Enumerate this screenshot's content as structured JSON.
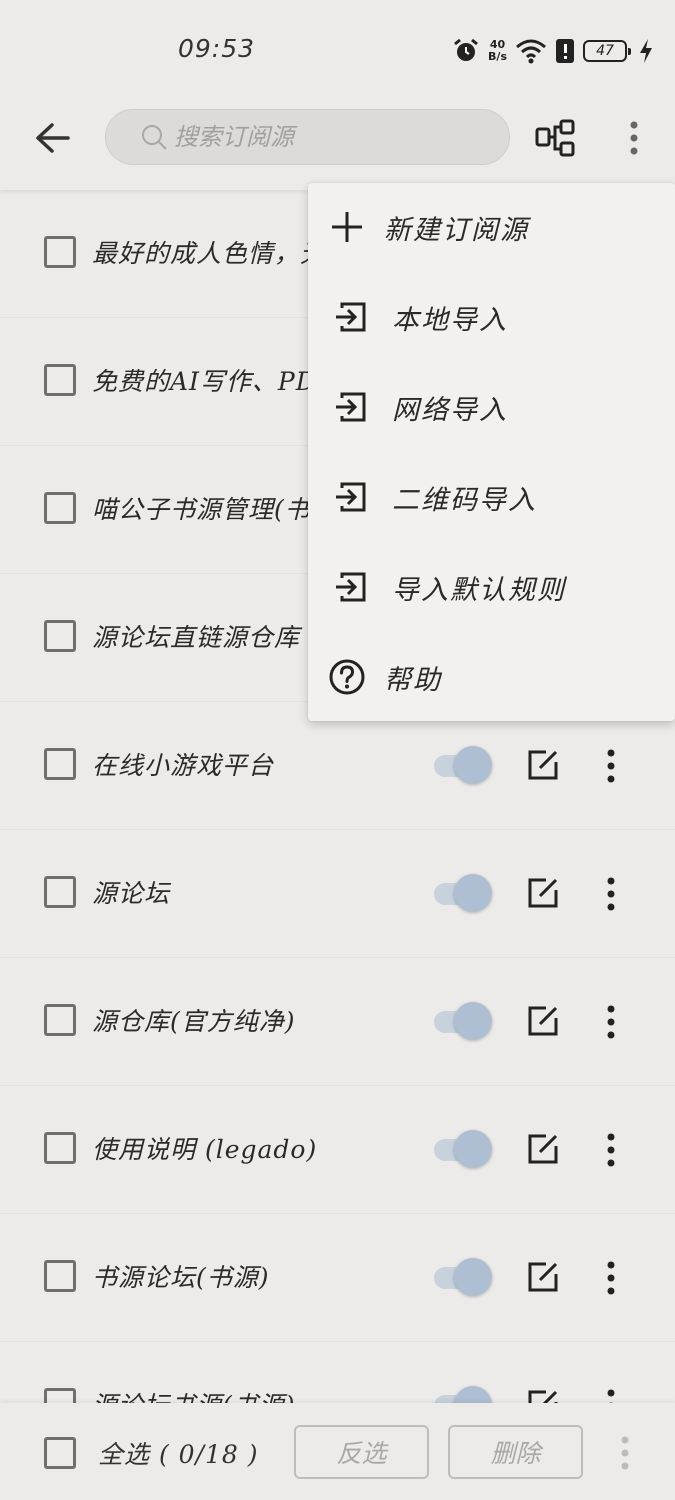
{
  "status_bar": {
    "time": "09:53",
    "net_speed_value": "40",
    "net_speed_unit": "B/s",
    "battery": "47"
  },
  "toolbar": {
    "search_placeholder": "搜索订阅源"
  },
  "menu": {
    "items": [
      {
        "label": "新建订阅源",
        "icon": "plus-icon"
      },
      {
        "label": "本地导入",
        "icon": "import-icon"
      },
      {
        "label": "网络导入",
        "icon": "import-icon"
      },
      {
        "label": "二维码导入",
        "icon": "import-icon"
      },
      {
        "label": "导入默认规则",
        "icon": "import-icon"
      },
      {
        "label": "帮助",
        "icon": "help-icon"
      }
    ]
  },
  "sources": [
    {
      "name": "最好的成人色情，无"
    },
    {
      "name": "免费的AI写作、PDF"
    },
    {
      "name": "喵公子书源管理(书"
    },
    {
      "name": "源论坛直链源仓库"
    },
    {
      "name": "在线小游戏平台"
    },
    {
      "name": "源论坛"
    },
    {
      "name": "源仓库(官方纯净)"
    },
    {
      "name": "使用说明 (legado)"
    },
    {
      "name": "书源论坛(书源)"
    },
    {
      "name": "源论坛书源(书源)"
    }
  ],
  "bottom_bar": {
    "select_all": "全选 ( 0/18 )",
    "invert_label": "反选",
    "delete_label": "删除"
  },
  "colors": {
    "background": "#ecebe9",
    "switch_on": "#aebfd3",
    "menu_bg": "#f2f1ef"
  }
}
